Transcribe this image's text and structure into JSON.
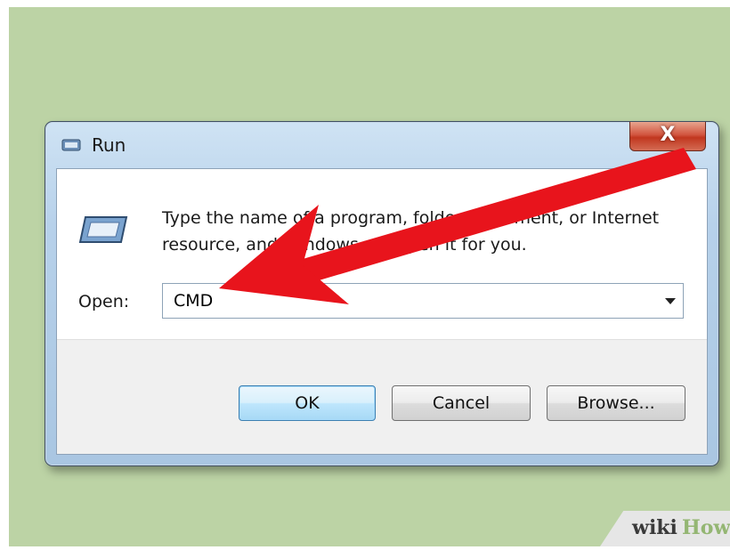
{
  "window": {
    "title": "Run",
    "close_glyph": "X",
    "description": "Type the name of a program, folder, document, or Internet resource, and Windows will open it for you.",
    "open_label": "Open:",
    "open_value": "CMD",
    "buttons": {
      "ok": "OK",
      "cancel": "Cancel",
      "browse": "Browse..."
    }
  },
  "icons": [
    "run-app-icon",
    "run-large-icon",
    "close-icon",
    "chevron-down-icon"
  ],
  "annotation": {
    "type": "red-arrow",
    "color": "#e8141c",
    "points_to": "open-combobox"
  },
  "watermark": {
    "brand_left": "wiki",
    "brand_right": "How",
    "colors": {
      "wiki": "#3a3a3a",
      "How": "#94b673"
    }
  },
  "colors": {
    "background": "#bcd3a5",
    "ok_border": "#3c7fb1",
    "close_button": "#c1371f"
  }
}
